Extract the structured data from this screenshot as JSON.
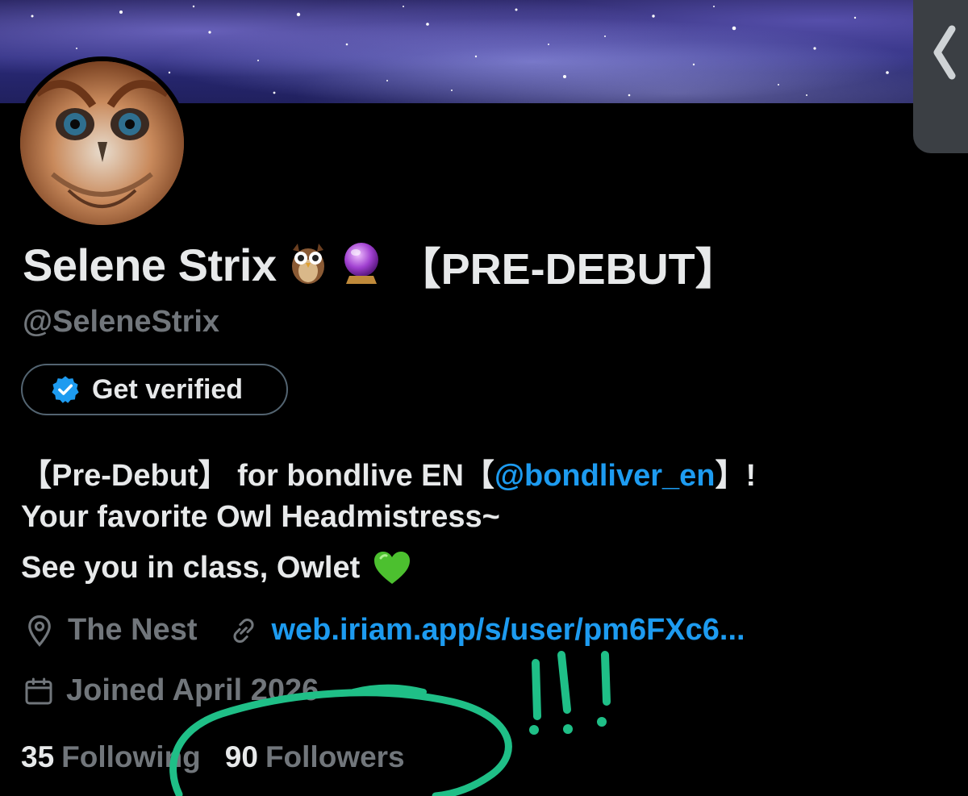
{
  "profile": {
    "display_name": "Selene Strix",
    "name_tag": "【PRE-DEBUT】",
    "handle": "@SeleneStrix",
    "verify_button_label": "Get verified",
    "bio": {
      "line1_prefix": "【Pre-Debut】 for bondlive EN【",
      "line1_mention": "@bondliver_en",
      "line1_suffix": "】!",
      "line2": "Your favorite Owl Headmistress~",
      "line3": "See you in class, Owlet"
    },
    "location": "The Nest",
    "website": "web.iriam.app/s/user/pm6FXc6...",
    "joined": "Joined April 2026",
    "following_count": "35",
    "following_label": "Following",
    "followers_count": "90",
    "followers_label": "Followers"
  },
  "icons": [
    "chevron-left-icon",
    "owl-emoji-icon",
    "crystal-ball-emoji-icon",
    "verified-badge-icon",
    "green-heart-emoji-icon",
    "location-pin-icon",
    "link-icon",
    "calendar-icon"
  ],
  "colors": {
    "background": "#000000",
    "text_primary": "#e7e9ea",
    "text_secondary": "#71767b",
    "link": "#1d9bf0",
    "annotation": "#1fbf87"
  }
}
